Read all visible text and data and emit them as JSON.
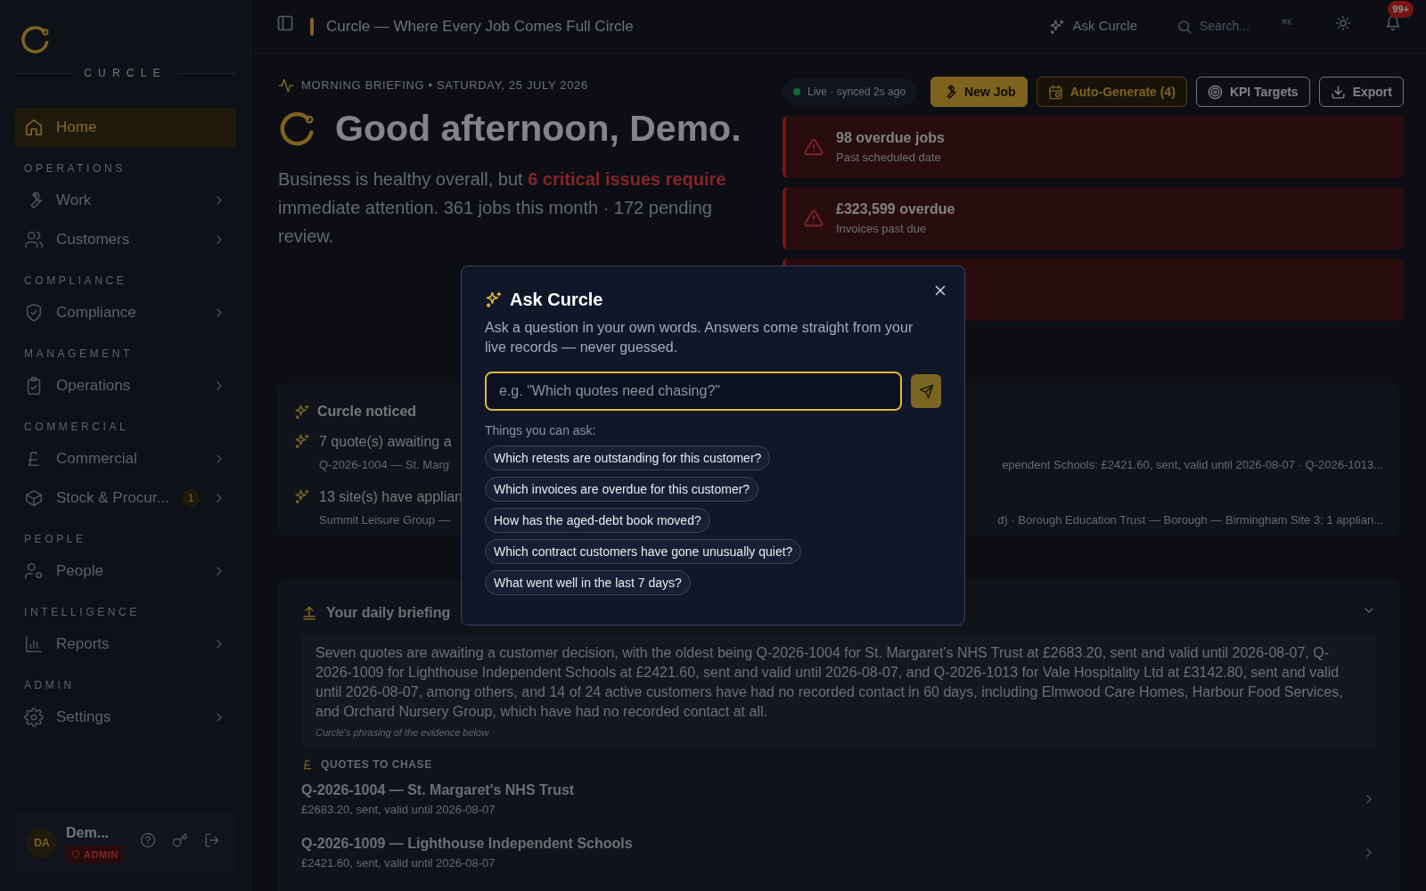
{
  "sidebar": {
    "brand": "CURCLE",
    "groups": [
      {
        "items": [
          {
            "label": "Home",
            "selected": true,
            "has_submenu": false
          }
        ]
      },
      {
        "heading": "OPERATIONS",
        "items": [
          {
            "label": "Work",
            "selected": false,
            "has_submenu": true
          },
          {
            "label": "Customers",
            "selected": false,
            "has_submenu": true
          }
        ]
      },
      {
        "heading": "COMPLIANCE",
        "items": [
          {
            "label": "Compliance",
            "selected": false,
            "has_submenu": true
          }
        ]
      },
      {
        "heading": "MANAGEMENT",
        "items": [
          {
            "label": "Operations",
            "selected": false,
            "has_submenu": true
          }
        ]
      },
      {
        "heading": "COMMERCIAL",
        "items": [
          {
            "label": "Commercial",
            "selected": false,
            "has_submenu": true
          },
          {
            "label": "Stock & Procur...",
            "selected": false,
            "has_submenu": true,
            "badge": "1"
          }
        ]
      },
      {
        "heading": "PEOPLE",
        "items": [
          {
            "label": "People",
            "selected": false,
            "has_submenu": true
          }
        ]
      },
      {
        "heading": "INTELLIGENCE",
        "items": [
          {
            "label": "Reports",
            "selected": false,
            "has_submenu": true
          }
        ]
      },
      {
        "heading": "ADMIN",
        "items": [
          {
            "label": "Settings",
            "selected": false,
            "has_submenu": true
          }
        ]
      }
    ],
    "user": {
      "initials": "DA",
      "name": "Dem...",
      "role": "ADMIN"
    }
  },
  "topbar": {
    "title": "Curcle — Where Every Job Comes Full Circle",
    "ask_label": "Ask Curcle",
    "search_label": "Search...",
    "search_shortcut": "⌘K",
    "notification_count": "99+"
  },
  "header": {
    "eyebrow": "MORNING BRIEFING • SATURDAY, 25 JULY 2026",
    "greeting": "Good afternoon, Demo.",
    "summary": "Business is healthy overall, but **6 critical issues require** immediate attention. 361 jobs this month · 172 pending review."
  },
  "status": {
    "label": "Live · synced 2s ago"
  },
  "actions": [
    {
      "label": "New Job",
      "kind": "primary"
    },
    {
      "label": "Auto-Generate (4)",
      "kind": "accent"
    },
    {
      "label": "KPI Targets",
      "kind": "default"
    },
    {
      "label": "Export",
      "kind": "default"
    }
  ],
  "alerts": [
    {
      "title": "98 overdue jobs",
      "subtitle": "Past scheduled date"
    },
    {
      "title": "£323,599 overdue",
      "subtitle": "Invoices past due"
    }
  ],
  "noticed": {
    "title": "Curcle noticed",
    "items": [
      {
        "title": "7 quote(s) awaiting a",
        "detail_start": "Q-2026-1004 — St. Marg",
        "detail_end": "ependent Schools: £2421.60, sent, valid until 2026-08-07 · Q-2026-1013..."
      },
      {
        "title": "13 site(s) have applian",
        "detail_start": "Summit Leisure Group —",
        "detail_end": "d) · Borough Education Trust — Borough — Birmingham Site 3: 1 applian..."
      }
    ]
  },
  "briefing": {
    "title": "Your daily briefing",
    "summary": "Seven quotes are awaiting a customer decision, with the oldest being Q-2026-1004 for St. Margaret's NHS Trust at £2683.20, sent and valid until 2026-08-07, Q-2026-1009 for Lighthouse Independent Schools at £2421.60, sent and valid until 2026-08-07, and Q-2026-1013 for Vale Hospitality Ltd at £3142.80, sent and valid until 2026-08-07, among others, and 14 of 24 active customers have had no recorded contact in 60 days, including Elmwood Care Homes, Harbour Food Services, and Orchard Nursery Group, which have had no recorded contact at all.",
    "footnote": "Curcle's phrasing of the evidence below",
    "section": "QUOTES TO CHASE",
    "quotes": [
      {
        "title": "Q-2026-1004 — St. Margaret's NHS Trust",
        "detail": "£2683.20, sent, valid until 2026-08-07"
      },
      {
        "title": "Q-2026-1009 — Lighthouse Independent Schools",
        "detail": "£2421.60, sent, valid until 2026-08-07"
      }
    ]
  },
  "modal": {
    "title": "Ask Curcle",
    "description": "Ask a question in your own words. Answers come straight from your live records — never guessed.",
    "placeholder": "e.g. \"Which quotes need chasing?\"",
    "suggestions_label": "Things you can ask:",
    "suggestions": [
      "Which retests are outstanding for this customer?",
      "Which invoices are overdue for this customer?",
      "How has the aged-debt book moved?",
      "Which contract customers have gone unusually quiet?",
      "What went well in the last 7 days?"
    ]
  }
}
